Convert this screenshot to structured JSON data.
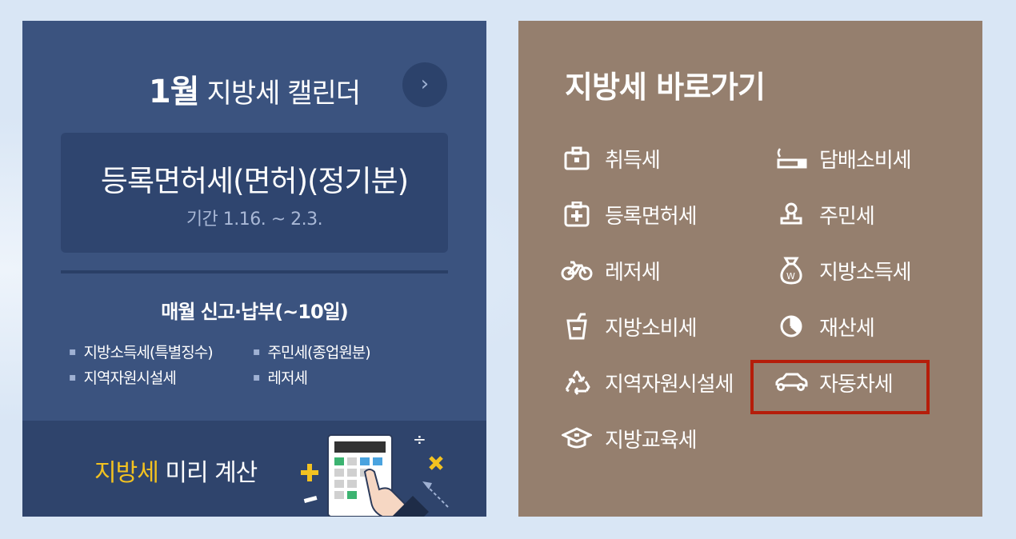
{
  "calendar": {
    "month": "1월",
    "title": "지방세 캘린더",
    "next_icon": "chevron-right-icon",
    "event": {
      "name": "등록면허세(면허)(정기분)",
      "period": "기간 1.16. ~ 2.3."
    },
    "monthly": {
      "title": "매월 신고·납부(~10일)",
      "items": [
        "지방소득세(특별징수)",
        "주민세(종업원분)",
        "지역자원시설세",
        "레저세"
      ]
    }
  },
  "calculator": {
    "accent_text": "지방세",
    "text": " 미리 계산",
    "accent_color": "#f3c220"
  },
  "shortcuts": {
    "title": "지방세 바로가기",
    "items": [
      {
        "label": "취득세",
        "icon": "briefcase-icon"
      },
      {
        "label": "담배소비세",
        "icon": "cigarette-icon"
      },
      {
        "label": "등록면허세",
        "icon": "medical-kit-icon"
      },
      {
        "label": "주민세",
        "icon": "stamp-icon"
      },
      {
        "label": "레저세",
        "icon": "bicycle-icon"
      },
      {
        "label": "지방소득세",
        "icon": "money-bag-icon"
      },
      {
        "label": "지방소비세",
        "icon": "drink-cup-icon"
      },
      {
        "label": "재산세",
        "icon": "pie-chart-icon"
      },
      {
        "label": "지역자원시설세",
        "icon": "recycle-icon"
      },
      {
        "label": "자동차세",
        "icon": "car-icon"
      },
      {
        "label": "지방교육세",
        "icon": "graduation-cap-icon"
      }
    ],
    "highlight_color": "#b51d0a"
  }
}
